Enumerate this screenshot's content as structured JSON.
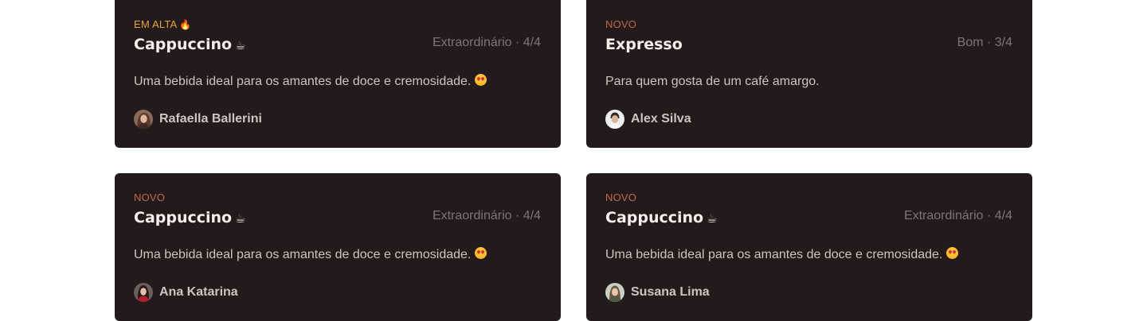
{
  "reviews": [
    {
      "badge": "EM ALTA",
      "badge_icon": "fire-icon",
      "title": "Cappuccino",
      "title_icon": "coffee-cup-icon",
      "rating_text": "Extraordinário · 4/4",
      "description": "Uma bebida ideal para os amantes de doce e cremosidade.",
      "description_icon": "heart-eyes-emoji-icon",
      "author": "Rafaella Ballerini"
    },
    {
      "badge": "NOVO",
      "title": "Expresso",
      "rating_text": "Bom · 3/4",
      "description": "Para quem gosta de um café amargo.",
      "author": "Alex Silva"
    },
    {
      "badge": "NOVO",
      "title": "Cappuccino",
      "title_icon": "coffee-cup-icon",
      "rating_text": "Extraordinário · 4/4",
      "description": "Uma bebida ideal para os amantes de doce e cremosidade.",
      "description_icon": "heart-eyes-emoji-icon",
      "author": "Ana Katarina"
    },
    {
      "badge": "NOVO",
      "title": "Cappuccino",
      "title_icon": "coffee-cup-icon",
      "rating_text": "Extraordinário · 4/4",
      "description": "Uma bebida ideal para os amantes de doce e cremosidade.",
      "description_icon": "heart-eyes-emoji-icon",
      "author": "Susana Lima"
    }
  ],
  "colors": {
    "card_background": "#221a1b",
    "badge_hot": "#e9a23a",
    "badge_new": "#c2674c",
    "title": "#f4efec",
    "rating": "#7e7576",
    "body_text": "#cdc5c3"
  }
}
